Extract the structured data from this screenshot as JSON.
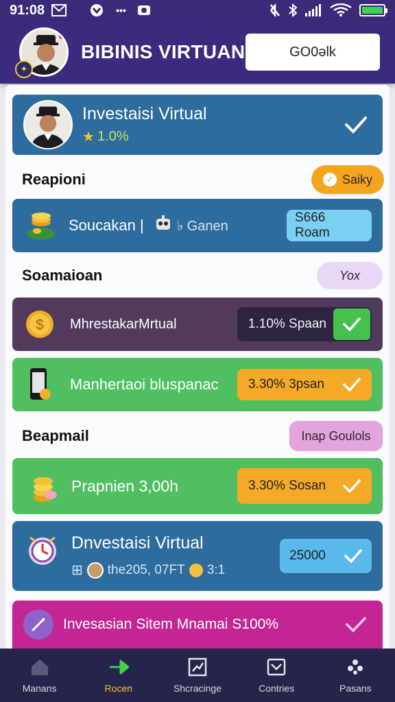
{
  "status_bar": {
    "time": "91:08",
    "icons": [
      "mail-icon",
      "vpn-icon",
      "more-icon",
      "record-icon",
      "no-sound-icon",
      "bluetooth-icon",
      "signal-icon",
      "wifi-icon",
      "battery-icon"
    ],
    "more": "•••"
  },
  "header": {
    "title": "BIBINIS VIRTUAN",
    "button_label": "GO0əlk"
  },
  "profile_card": {
    "title": "Investaisi Virtual",
    "rating": "1.0%",
    "color": "#2d6c9c"
  },
  "section_1": {
    "title": "Reapioni",
    "pill": "Saiky",
    "pill_color": "#f3a51f"
  },
  "card_1": {
    "title": "Soucakan |",
    "subtitle": "♭ Ganen",
    "pill": "S666 Roam",
    "pill_color": "#7ad0f2"
  },
  "section_2": {
    "title": "Soamaioan",
    "pill": "Yox",
    "pill_color": "#e8d8f6"
  },
  "card_2": {
    "title": "MhrestakarMrtual",
    "pill": "1.10% Spaan",
    "color": "#513a5c"
  },
  "card_3": {
    "title": "Manhertaoi bluspanac",
    "pill": "3.30% 3psan",
    "color": "#4fbf61",
    "pill_color": "#f5a926"
  },
  "section_3": {
    "title": "Beapmail",
    "pill": "Inap Goulols",
    "pill_color": "#e3a3dc"
  },
  "card_4": {
    "title": "Prapnien 3,00h",
    "pill": "3.30% Sosan",
    "color": "#4fbf61",
    "pill_color": "#f5a926"
  },
  "card_5": {
    "title": "Dnvestaisi Virtual",
    "subtitle": "the205, 07FT",
    "subtitle_tail": "3:1",
    "pill": "25000",
    "color": "#2d6c9c",
    "pill_color": "#5ab8ea"
  },
  "card_6": {
    "title": "Invesasian Sitem Mnamai S100%",
    "color": "#c32594"
  },
  "bottom_nav": {
    "items": [
      {
        "label": "Manans",
        "icon": "home-icon"
      },
      {
        "label": "Rocen",
        "icon": "arrow-right-icon"
      },
      {
        "label": "Shcracinge",
        "icon": "chart-square-icon"
      },
      {
        "label": "Contries",
        "icon": "inbox-check-icon"
      },
      {
        "label": "Pasans",
        "icon": "people-icon"
      }
    ],
    "active_color": "#f5c534"
  }
}
